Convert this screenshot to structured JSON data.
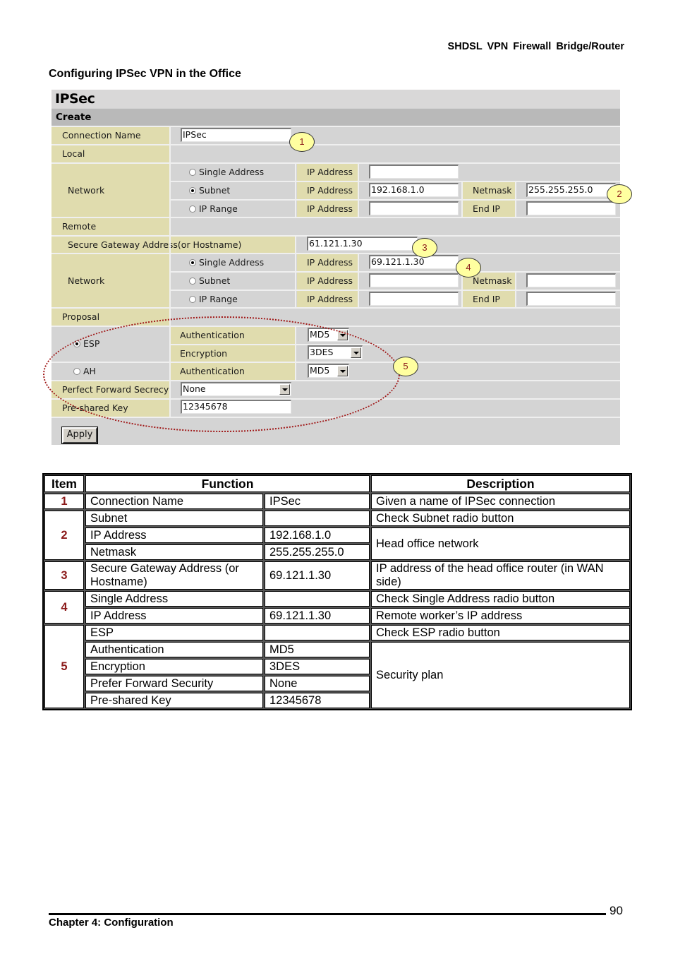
{
  "header": {
    "product": "SHDSL  VPN  Firewall  Bridge/Router"
  },
  "section_title": "Configuring IPSec VPN in the Office",
  "panel": {
    "title": "IPSec",
    "create": "Create",
    "connection_name_label": "Connection Name",
    "connection_name_value": "IPSec",
    "local_label": "Local",
    "local": {
      "network_label": "Network",
      "options": [
        {
          "label": "Single Address",
          "checked": false,
          "field1_label": "IP Address",
          "field1_value": ""
        },
        {
          "label": "Subnet",
          "checked": true,
          "field1_label": "IP Address",
          "field1_value": "192.168.1.0",
          "field2_label": "Netmask",
          "field2_value": "255.255.255.0"
        },
        {
          "label": "IP Range",
          "checked": false,
          "field1_label": "IP Address",
          "field1_value": "",
          "field2_label": "End IP",
          "field2_value": ""
        }
      ]
    },
    "remote_label": "Remote",
    "remote": {
      "gateway_label": "Secure Gateway Address(or Hostname)",
      "gateway_value": "61.121.1.30",
      "network_label": "Network",
      "options": [
        {
          "label": "Single Address",
          "checked": true,
          "field1_label": "IP Address",
          "field1_value": "69.121.1.30"
        },
        {
          "label": "Subnet",
          "checked": false,
          "field1_label": "IP Address",
          "field1_value": "",
          "field2_label": "Netmask",
          "field2_value": ""
        },
        {
          "label": "IP Range",
          "checked": false,
          "field1_label": "IP Address",
          "field1_value": "",
          "field2_label": "End IP",
          "field2_value": ""
        }
      ]
    },
    "proposal_label": "Proposal",
    "proposal": {
      "esp_label": "ESP",
      "esp_checked": true,
      "esp_auth_label": "Authentication",
      "esp_auth_value": "MD5",
      "esp_enc_label": "Encryption",
      "esp_enc_value": "3DES",
      "ah_label": "AH",
      "ah_checked": false,
      "ah_auth_label": "Authentication",
      "ah_auth_value": "MD5"
    },
    "pfs_label": "Perfect Forward Secrecy",
    "pfs_value": "None",
    "psk_label": "Pre-shared Key",
    "psk_value": "12345678",
    "apply_label": "Apply"
  },
  "callouts": [
    "1",
    "2",
    "3",
    "4",
    "5"
  ],
  "table": {
    "headers": {
      "item": "Item",
      "function": "Function",
      "description": "Description"
    },
    "rows": [
      {
        "item": "1",
        "function": "Connection Name",
        "value": "IPSec",
        "description": "Given a name of IPSec connection"
      },
      {
        "item": "2",
        "function": "Subnet",
        "value": "",
        "description": "Check Subnet radio button"
      },
      {
        "function": "IP Address",
        "value": "192.168.1.0",
        "description": "Head office network"
      },
      {
        "function": "Netmask",
        "value": "255.255.255.0"
      },
      {
        "item": "3",
        "function": "Secure Gateway Address (or Hostname)",
        "value": "69.121.1.30",
        "description": "IP address of the head office router (in WAN side)"
      },
      {
        "item": "4",
        "function": "Single Address",
        "value": "",
        "description": "Check Single Address radio button"
      },
      {
        "function": "IP Address",
        "value": "69.121.1.30",
        "description": "Remote worker’s IP address"
      },
      {
        "item": "5",
        "function": "ESP",
        "value": "",
        "description": "Check ESP radio button"
      },
      {
        "function": "Authentication",
        "value": "MD5",
        "description": "Security plan"
      },
      {
        "function": "Encryption",
        "value": "3DES"
      },
      {
        "function": "Prefer Forward Security",
        "value": "None"
      },
      {
        "function": "Pre-shared Key",
        "value": "12345678"
      }
    ]
  },
  "footer": {
    "page_number": "90",
    "chapter": "Chapter 4: Configuration"
  }
}
